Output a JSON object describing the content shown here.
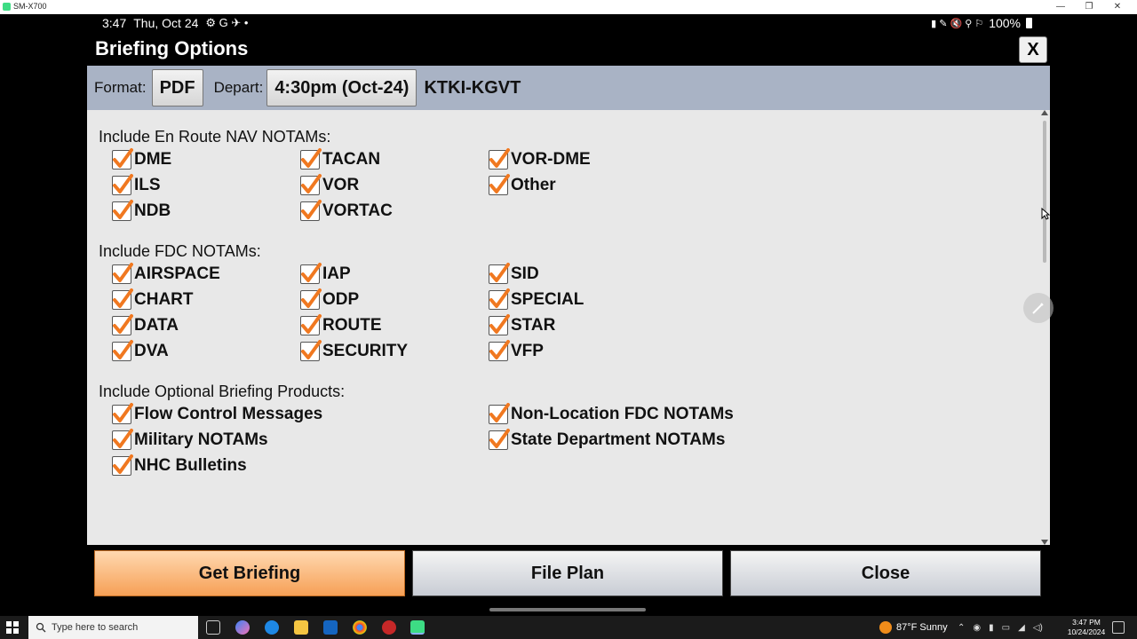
{
  "host_window": {
    "title": "SM-X700",
    "min": "—",
    "restore": "❐",
    "close": "✕"
  },
  "status_bar": {
    "time": "3:47",
    "date": "Thu, Oct 24",
    "left_icons": "⚙ G ✈ •",
    "right_icons": "▮ ✎ 🔇 ⚲ ⚐",
    "battery": "100%"
  },
  "dialog": {
    "title": "Briefing Options",
    "close_x": "X"
  },
  "options_bar": {
    "format_label": "Format:",
    "format_value": "PDF",
    "depart_label": "Depart:",
    "depart_value": "4:30pm (Oct-24)",
    "route": "KTKI-KGVT"
  },
  "sections": {
    "nav": {
      "header": "Include En Route NAV NOTAMs:",
      "items": [
        {
          "label": "DME",
          "checked": true
        },
        {
          "label": "TACAN",
          "checked": true
        },
        {
          "label": "VOR-DME",
          "checked": true
        },
        {
          "label": "ILS",
          "checked": true
        },
        {
          "label": "VOR",
          "checked": true
        },
        {
          "label": "Other",
          "checked": true
        },
        {
          "label": "NDB",
          "checked": true
        },
        {
          "label": "VORTAC",
          "checked": true
        }
      ]
    },
    "fdc": {
      "header": "Include FDC NOTAMs:",
      "items": [
        {
          "label": "AIRSPACE",
          "checked": true
        },
        {
          "label": "IAP",
          "checked": true
        },
        {
          "label": "SID",
          "checked": true
        },
        {
          "label": "CHART",
          "checked": true
        },
        {
          "label": "ODP",
          "checked": true
        },
        {
          "label": "SPECIAL",
          "checked": true
        },
        {
          "label": "DATA",
          "checked": true
        },
        {
          "label": "ROUTE",
          "checked": true
        },
        {
          "label": "STAR",
          "checked": true
        },
        {
          "label": "DVA",
          "checked": true
        },
        {
          "label": "SECURITY",
          "checked": true
        },
        {
          "label": "VFP",
          "checked": true
        }
      ]
    },
    "optional": {
      "header": "Include Optional Briefing Products:",
      "items": [
        {
          "label": "Flow Control Messages",
          "checked": true
        },
        {
          "label": "Non-Location FDC NOTAMs",
          "checked": true
        },
        {
          "label": "Military NOTAMs",
          "checked": true
        },
        {
          "label": "State Department NOTAMs",
          "checked": true
        },
        {
          "label": "NHC Bulletins",
          "checked": true
        }
      ]
    }
  },
  "buttons": {
    "get_briefing": "Get Briefing",
    "file_plan": "File Plan",
    "close": "Close"
  },
  "colors": {
    "check_orange": "#f07820",
    "options_bar": "#a9b3c5",
    "get_briefing": "#f6a056"
  },
  "taskbar": {
    "search_placeholder": "Type here to search",
    "weather": "87°F  Sunny",
    "clock_time": "3:47 PM",
    "clock_date": "10/24/2024"
  }
}
